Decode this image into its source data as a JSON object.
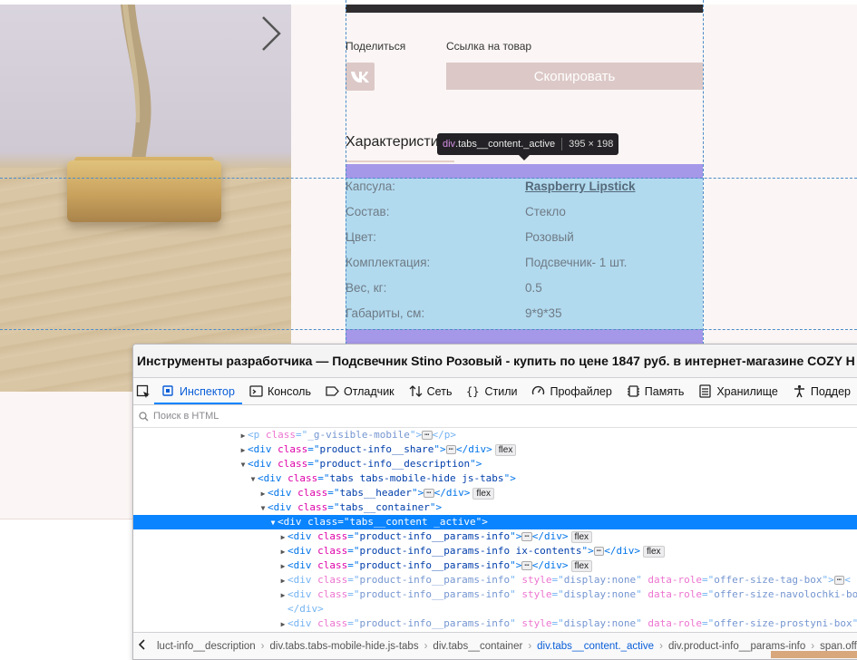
{
  "product": {
    "share_label": "Поделиться",
    "link_label": "Ссылка на товар",
    "copy_button": "Скопировать",
    "tab_title": "Характеристики",
    "params": [
      {
        "key": "Капсула:",
        "value": "Raspberry Lipstick",
        "link": true
      },
      {
        "key": "Состав:",
        "value": "Стекло",
        "link": false
      },
      {
        "key": "Цвет:",
        "value": "Розовый",
        "link": false
      },
      {
        "key": "Комплектация:",
        "value": "Подсвечник- 1 шт.",
        "link": false
      },
      {
        "key": "Вес, кг:",
        "value": "0.5",
        "link": false
      },
      {
        "key": "Габариты, см:",
        "value": "9*9*35",
        "link": false
      }
    ]
  },
  "inspector_tooltip": {
    "tag": "div",
    "classes": ".tabs__content._active",
    "size": "395 × 198"
  },
  "devtools": {
    "title": "Инструменты разработчика — Подсвечник Stino Розовый - купить по цене 1847 руб. в интернет-магазине COZY H",
    "tabs": [
      {
        "label": "Инспектор",
        "icon": "inspector-icon",
        "active": true
      },
      {
        "label": "Консоль",
        "icon": "console-icon",
        "active": false
      },
      {
        "label": "Отладчик",
        "icon": "debugger-icon",
        "active": false
      },
      {
        "label": "Сеть",
        "icon": "network-icon",
        "active": false
      },
      {
        "label": "Стили",
        "icon": "style-editor-icon",
        "active": false
      },
      {
        "label": "Профайлер",
        "icon": "profiler-icon",
        "active": false
      },
      {
        "label": "Память",
        "icon": "memory-icon",
        "active": false
      },
      {
        "label": "Хранилище",
        "icon": "storage-icon",
        "active": false
      },
      {
        "label": "Поддер",
        "icon": "accessibility-icon",
        "active": false
      }
    ],
    "search_placeholder": "Поиск в HTML",
    "nodes": [
      {
        "depth": 0,
        "twisty": "right",
        "dim": true,
        "tag": "p",
        "attrs": [
          [
            "class",
            "_g-visible-mobile"
          ]
        ],
        "collapsed": true,
        "close": "p",
        "badge": ""
      },
      {
        "depth": 0,
        "twisty": "right",
        "dim": false,
        "tag": "div",
        "attrs": [
          [
            "class",
            "product-info__share"
          ]
        ],
        "collapsed": true,
        "close": "div",
        "badge": "flex"
      },
      {
        "depth": 0,
        "twisty": "down",
        "dim": false,
        "tag": "div",
        "attrs": [
          [
            "class",
            "product-info__description"
          ]
        ],
        "collapsed": false,
        "close": "",
        "badge": ""
      },
      {
        "depth": 1,
        "twisty": "down",
        "dim": false,
        "tag": "div",
        "attrs": [
          [
            "class",
            "tabs tabs-mobile-hide js-tabs"
          ]
        ],
        "collapsed": false,
        "close": "",
        "badge": ""
      },
      {
        "depth": 2,
        "twisty": "right",
        "dim": false,
        "tag": "div",
        "attrs": [
          [
            "class",
            "tabs__header"
          ]
        ],
        "collapsed": true,
        "close": "div",
        "badge": "flex"
      },
      {
        "depth": 2,
        "twisty": "down",
        "dim": false,
        "tag": "div",
        "attrs": [
          [
            "class",
            "tabs__container"
          ]
        ],
        "collapsed": false,
        "close": "",
        "badge": ""
      },
      {
        "depth": 3,
        "twisty": "down",
        "dim": false,
        "selected": true,
        "tag": "div",
        "attrs": [
          [
            "class",
            "tabs__content _active"
          ]
        ],
        "collapsed": false,
        "close": "",
        "badge": ""
      },
      {
        "depth": 4,
        "twisty": "right",
        "dim": false,
        "tag": "div",
        "attrs": [
          [
            "class",
            "product-info__params-info"
          ]
        ],
        "collapsed": true,
        "close": "div",
        "badge": "flex"
      },
      {
        "depth": 4,
        "twisty": "right",
        "dim": false,
        "tag": "div",
        "attrs": [
          [
            "class",
            "product-info__params-info ix-contents"
          ]
        ],
        "collapsed": true,
        "close": "div",
        "badge": "flex"
      },
      {
        "depth": 4,
        "twisty": "right",
        "dim": false,
        "tag": "div",
        "attrs": [
          [
            "class",
            "product-info__params-info"
          ]
        ],
        "collapsed": true,
        "close": "div",
        "badge": "flex"
      },
      {
        "depth": 4,
        "twisty": "right",
        "dim": true,
        "tag": "div",
        "attrs": [
          [
            "class",
            "product-info__params-info"
          ],
          [
            "style",
            "display:none"
          ],
          [
            "data-role",
            "offer-size-tag-box"
          ]
        ],
        "collapsed": true,
        "close": "",
        "badge": "",
        "trail": "<"
      },
      {
        "depth": 4,
        "twisty": "right",
        "dim": true,
        "tag": "div",
        "attrs": [
          [
            "class",
            "product-info__params-info"
          ],
          [
            "style",
            "display:none"
          ],
          [
            "data-role",
            "offer-size-navolochki-box"
          ]
        ],
        "collapsed": false,
        "close": "",
        "badge": ""
      },
      {
        "depth": 4,
        "twisty": "none",
        "dim": true,
        "closing_only": "div",
        "badge": ""
      },
      {
        "depth": 4,
        "twisty": "right",
        "dim": true,
        "tag": "div",
        "attrs": [
          [
            "class",
            "product-info__params-info"
          ],
          [
            "style",
            "display:none"
          ],
          [
            "data-role",
            "offer-size-prostyni-box"
          ]
        ],
        "collapsed": false,
        "close": "",
        "badge": ""
      }
    ],
    "breadcrumbs": [
      {
        "label": "luct-info__description",
        "active": false
      },
      {
        "label": "div.tabs.tabs-mobile-hide.js-tabs",
        "active": false
      },
      {
        "label": "div.tabs__container",
        "active": false
      },
      {
        "label": "div.tabs__content._active",
        "active": true
      },
      {
        "label": "div.product-info__params-info",
        "active": false
      },
      {
        "label": "span.offe",
        "active": false
      }
    ]
  }
}
